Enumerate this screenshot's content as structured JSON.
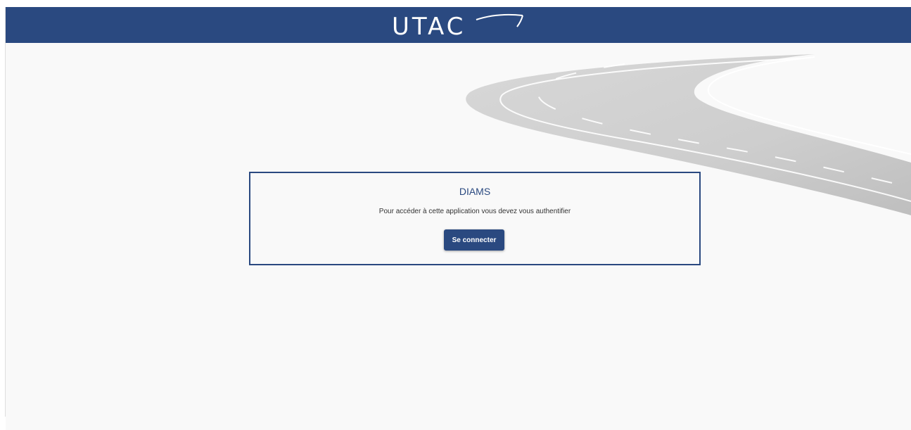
{
  "header": {
    "logo_text": "UTAC",
    "logo_icon": "utac-logo-swoosh",
    "background_color": "#2a4980"
  },
  "card": {
    "title": "DIAMS",
    "message": "Pour accéder à cette application vous devez vous authentifier",
    "login_button_label": "Se connecter",
    "border_color": "#2a4980"
  },
  "background": {
    "illustration": "road-illustration",
    "color": "#f9f9f9"
  }
}
